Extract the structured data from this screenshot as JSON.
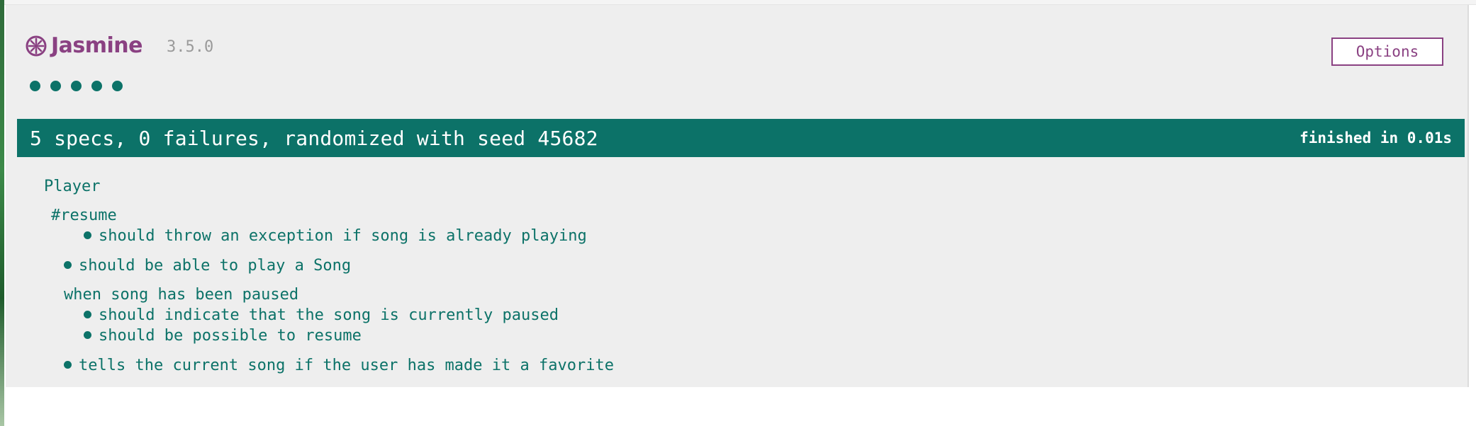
{
  "header": {
    "logo_text": "Jasmine",
    "version": "3.5.0",
    "options_label": "Options"
  },
  "progress": {
    "passed_count": 5
  },
  "summary": {
    "text": "5 specs, 0 failures, randomized with seed 45682",
    "duration": "finished in 0.01s"
  },
  "suite": {
    "name": "Player",
    "groups": [
      {
        "name": "#resume",
        "specs": [
          "should throw an exception if song is already playing"
        ]
      }
    ],
    "spec_play": "should be able to play a Song",
    "paused_group": {
      "name": "when song has been paused",
      "specs": [
        "should indicate that the song is currently paused",
        "should be possible to resume"
      ]
    },
    "spec_favorite": "tells the current song if the user has made it a favorite"
  },
  "colors": {
    "accent": "#8a4182",
    "pass": "#0c7268",
    "panel": "#eeeeee"
  },
  "icons": {
    "logo": "jasmine-flower-icon"
  }
}
